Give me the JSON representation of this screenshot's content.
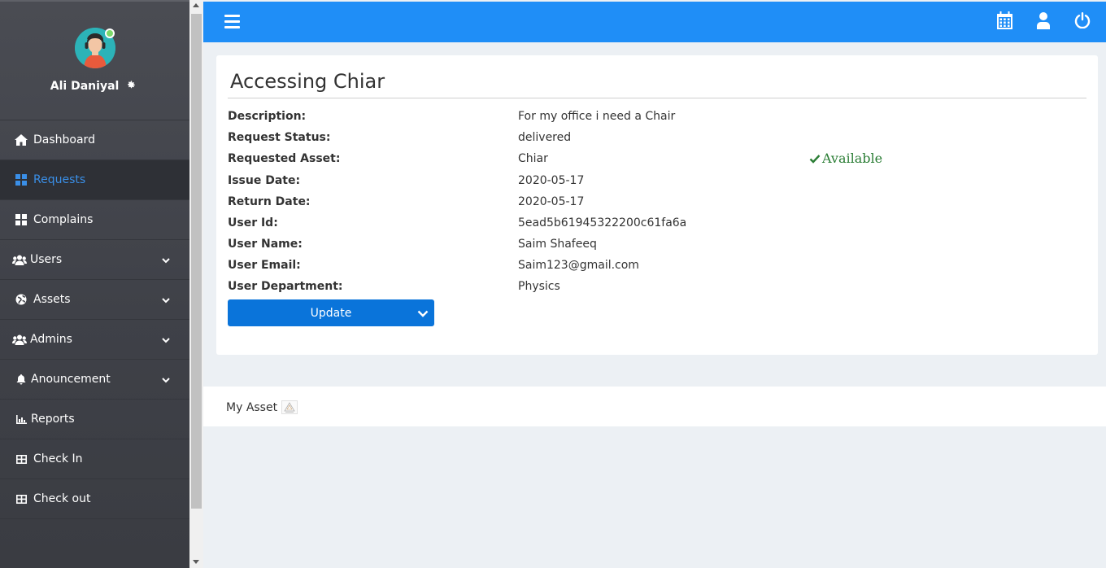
{
  "sidebar": {
    "profile_name": "Ali Daniyal",
    "items": [
      {
        "label": "Dashboard",
        "icon": "home-icon"
      },
      {
        "label": "Requests",
        "icon": "grid-icon"
      },
      {
        "label": "Complains",
        "icon": "grid-icon"
      },
      {
        "label": "Users",
        "icon": "users-icon"
      },
      {
        "label": "Assets",
        "icon": "globe-icon"
      },
      {
        "label": "Admins",
        "icon": "users-icon"
      },
      {
        "label": "Anouncement",
        "icon": "bell-icon"
      },
      {
        "label": "Reports",
        "icon": "chart-icon"
      },
      {
        "label": "Check In",
        "icon": "table-icon"
      },
      {
        "label": "Check out",
        "icon": "table-icon"
      }
    ]
  },
  "request": {
    "title": "Accessing Chiar",
    "fields": [
      {
        "label": "Description:",
        "value": "For my office i need a Chair"
      },
      {
        "label": "Request Status:",
        "value": "delivered"
      },
      {
        "label": "Requested Asset:",
        "value": "Chiar"
      },
      {
        "label": "Issue Date:",
        "value": "2020-05-17"
      },
      {
        "label": "Return Date:",
        "value": "2020-05-17"
      },
      {
        "label": "User Id:",
        "value": "5ead5b61945322200c61fa6a"
      },
      {
        "label": "User Name:",
        "value": "Saim Shafeeq"
      },
      {
        "label": "User Email:",
        "value": "Saim123@gmail.com"
      },
      {
        "label": "User Department:",
        "value": "Physics"
      }
    ],
    "availability": "Available",
    "update_label": "Update"
  },
  "footer": {
    "text": "My Asset"
  },
  "colors": {
    "topbar": "#1f8ef7",
    "sidebar": "#43454c",
    "active_text": "#3a8fe8",
    "button": "#0a74da",
    "available": "#2a7d34"
  }
}
